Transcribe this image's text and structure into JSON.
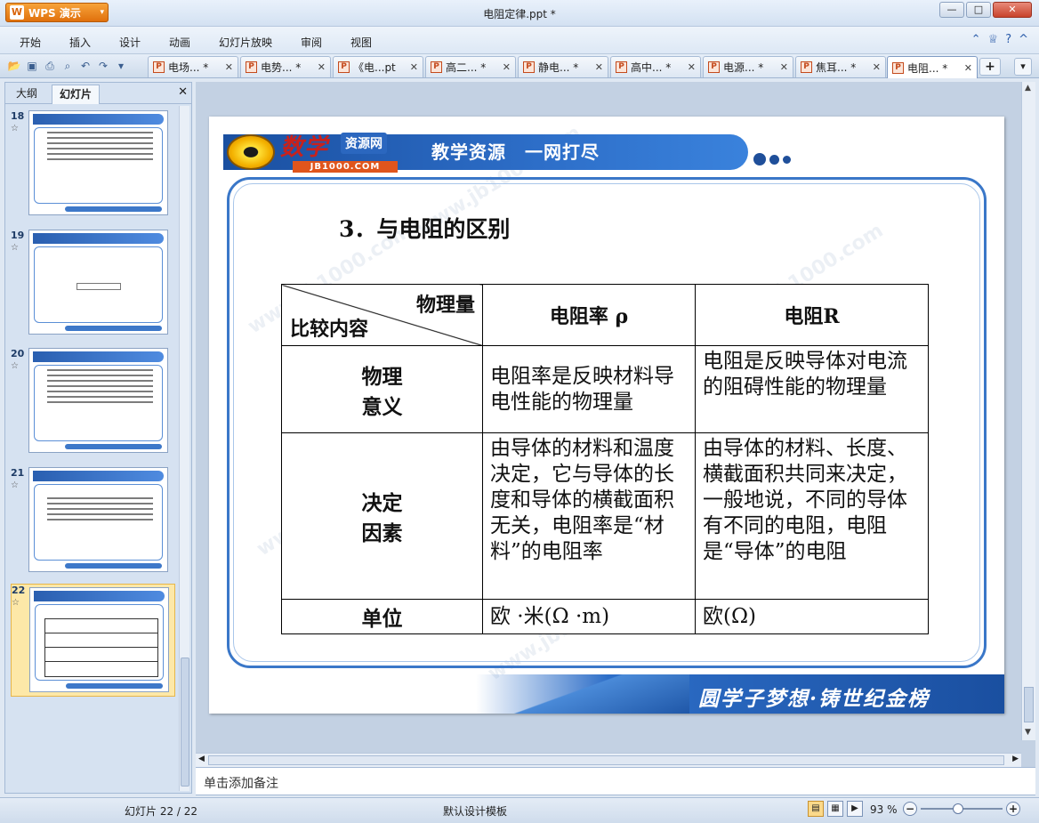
{
  "app": {
    "name": "WPS 演示",
    "doc_title": "电阻定律.ppt *"
  },
  "menu": [
    "开始",
    "插入",
    "设计",
    "动画",
    "幻灯片放映",
    "审阅",
    "视图"
  ],
  "doc_tabs": [
    {
      "label": "电场... *",
      "active": false
    },
    {
      "label": "电势... *",
      "active": false
    },
    {
      "label": "《电...pt",
      "active": false
    },
    {
      "label": "高二... *",
      "active": false
    },
    {
      "label": "静电... *",
      "active": false
    },
    {
      "label": "高中... *",
      "active": false
    },
    {
      "label": "电源... *",
      "active": false
    },
    {
      "label": "焦耳... *",
      "active": false
    },
    {
      "label": "电阻... *",
      "active": true
    }
  ],
  "panel": {
    "tab_outline": "大纲",
    "tab_slides": "幻灯片",
    "thumbs": [
      {
        "num": "18",
        "selected": false
      },
      {
        "num": "19",
        "selected": false
      },
      {
        "num": "20",
        "selected": false
      },
      {
        "num": "21",
        "selected": false
      },
      {
        "num": "22",
        "selected": true
      }
    ]
  },
  "slide": {
    "brand": "数学",
    "brand_site": "资源网",
    "brand_url": "JB1000.COM",
    "slogan_top": "教学资源　一网打尽",
    "heading": "3．与电阻的区别",
    "table": {
      "corner_top": "物理量",
      "corner_bottom": "比较内容",
      "col1_header": "电阻率 ρ",
      "col2_header": "电阻R",
      "rows": [
        {
          "head": "物理\n意义",
          "c1": "电阻率是反映材料导电性能的物理量",
          "c2": "电阻是反映导体对电流的阻碍性能的物理量"
        },
        {
          "head": "决定\n因素",
          "c1": "由导体的材料和温度决定，它与导体的长度和导体的横截面积无关，电阻率是“材料”的电阻率",
          "c2": "由导体的材料、长度、横截面积共同来决定，一般地说，不同的导体有不同的电阻，电阻是“导体”的电阻"
        },
        {
          "head": "单位",
          "c1": "欧 ·米(Ω ·m)",
          "c2": "欧(Ω)"
        }
      ]
    },
    "slogan_bottom": "圆学子梦想·铸世纪金榜",
    "watermark": "www.jb1000.com"
  },
  "notes_placeholder": "单击添加备注",
  "status": {
    "slide_counter": "幻灯片 22 / 22",
    "template": "默认设计模板",
    "zoom": "93 %"
  }
}
